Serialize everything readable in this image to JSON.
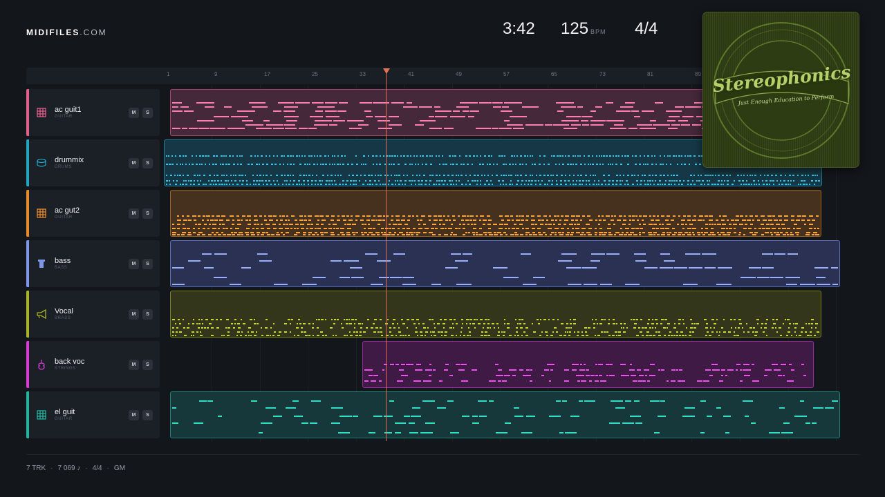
{
  "brand": {
    "bold": "MIDIFILES",
    "light": ".COM"
  },
  "stats": {
    "time": "3:42",
    "tempo": "125",
    "tempo_unit": "BPM",
    "signature": "4/4"
  },
  "ruler": {
    "ticks": [
      "1",
      "9",
      "17",
      "25",
      "33",
      "41",
      "49",
      "57",
      "65",
      "73",
      "81",
      "89"
    ]
  },
  "tracks": [
    {
      "name": "ac guit1",
      "instrument": "GUITAR",
      "icon": "guitar-grid-icon",
      "color": "#e0608a",
      "mute": "M",
      "solo": "S"
    },
    {
      "name": "drummix",
      "instrument": "DRUMS",
      "icon": "drum-icon",
      "color": "#22a3c0",
      "mute": "M",
      "solo": "S"
    },
    {
      "name": "ac gut2",
      "instrument": "GUITAR",
      "icon": "guitar-grid-icon",
      "color": "#e88a2a",
      "mute": "M",
      "solo": "S"
    },
    {
      "name": "bass",
      "instrument": "BASS",
      "icon": "bass-icon",
      "color": "#7e96e6",
      "mute": "M",
      "solo": "S"
    },
    {
      "name": "Vocal",
      "instrument": "BRASS",
      "icon": "horn-icon",
      "color": "#a8b424",
      "mute": "M",
      "solo": "S"
    },
    {
      "name": "back voc",
      "instrument": "STRINGS",
      "icon": "violin-icon",
      "color": "#d83ad8",
      "mute": "M",
      "solo": "S"
    },
    {
      "name": "el guit",
      "instrument": "GUITAR",
      "icon": "guitar-grid-icon",
      "color": "#22b4a0",
      "mute": "M",
      "solo": "S"
    }
  ],
  "album": {
    "artist": "Stereophonics",
    "title": "Just Enough Education to Perform"
  },
  "footer": {
    "tracks": "7 TRK",
    "notes": "7 069 ♪",
    "signature": "4/4",
    "standard": "GM"
  }
}
